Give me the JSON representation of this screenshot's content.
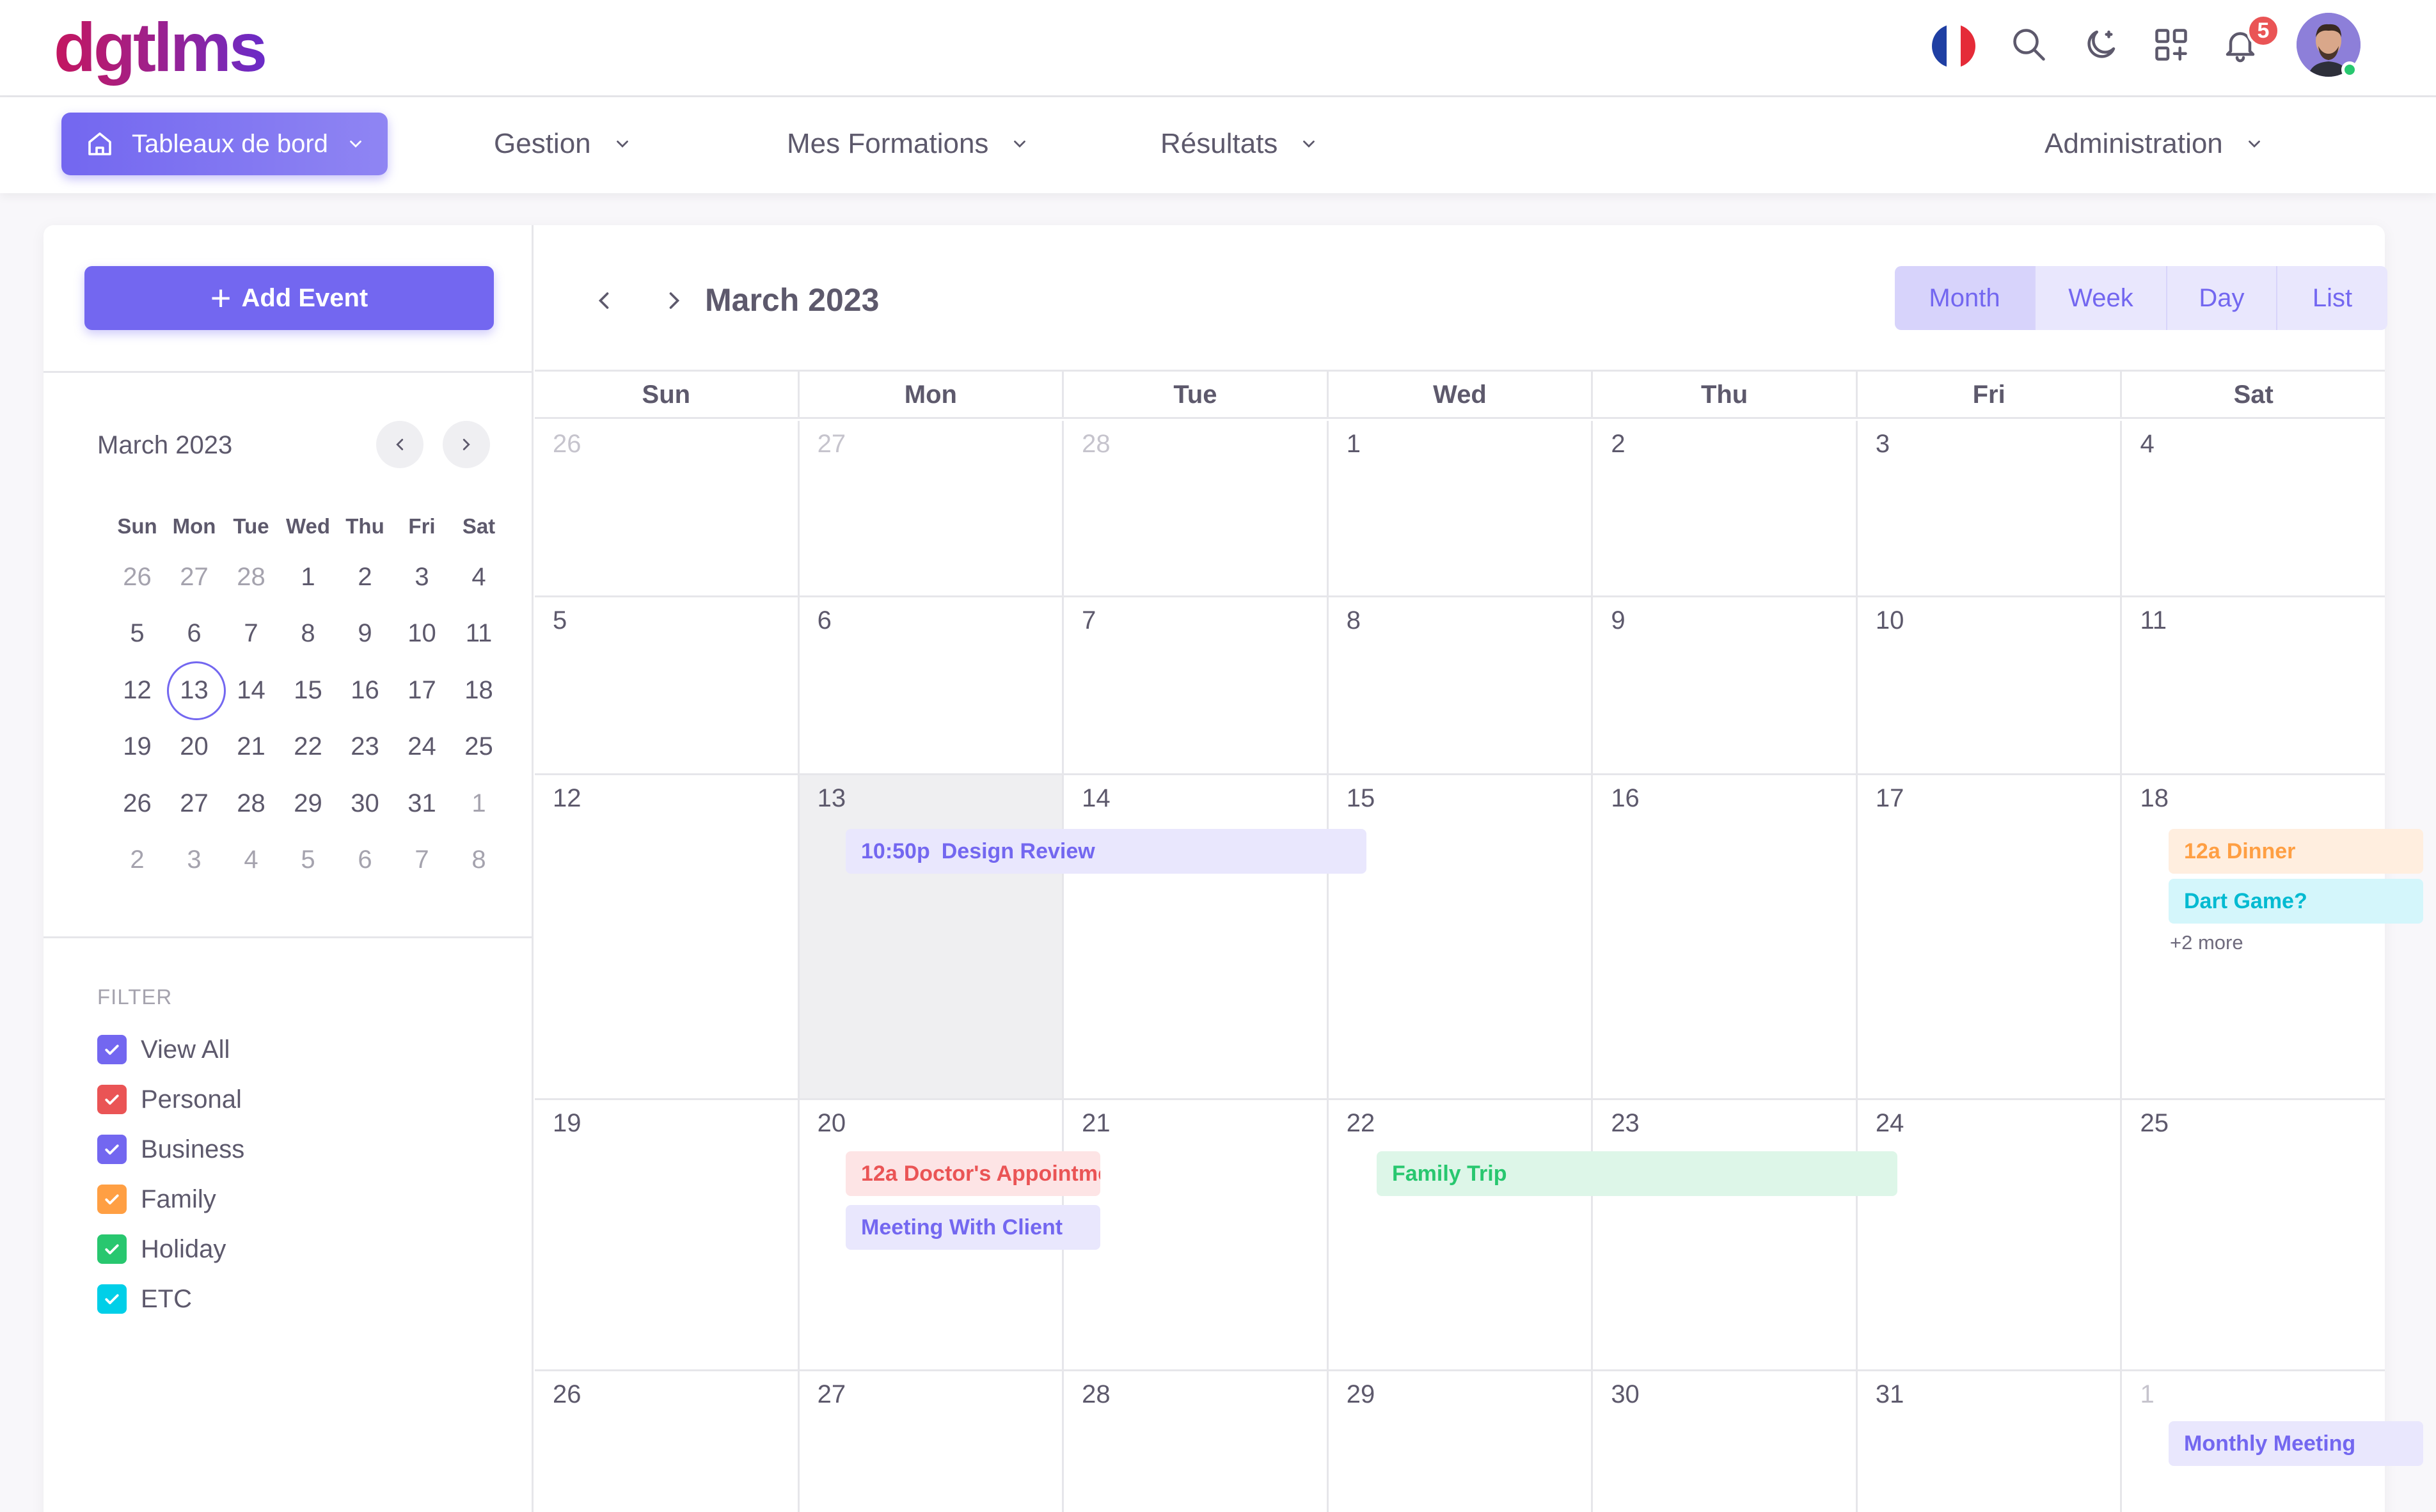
{
  "brand": {
    "logo": "dgtlms"
  },
  "topbar": {
    "notifications_count": "5",
    "language": "FR"
  },
  "menu": {
    "dashboards": "Tableaux de bord",
    "gestion": "Gestion",
    "formations": "Mes Formations",
    "resultats": "Résultats",
    "administration": "Administration"
  },
  "sidebar": {
    "add_event": "Add Event",
    "mini_calendar": {
      "title": "March 2023",
      "weekdays": [
        "Sun",
        "Mon",
        "Tue",
        "Wed",
        "Thu",
        "Fri",
        "Sat"
      ],
      "weeks": [
        [
          "26",
          "27",
          "28",
          "1",
          "2",
          "3",
          "4"
        ],
        [
          "5",
          "6",
          "7",
          "8",
          "9",
          "10",
          "11"
        ],
        [
          "12",
          "13",
          "14",
          "15",
          "16",
          "17",
          "18"
        ],
        [
          "19",
          "20",
          "21",
          "22",
          "23",
          "24",
          "25"
        ],
        [
          "26",
          "27",
          "28",
          "29",
          "30",
          "31",
          "1"
        ],
        [
          "2",
          "3",
          "4",
          "5",
          "6",
          "7",
          "8"
        ]
      ],
      "today": "13"
    },
    "filter": {
      "title": "FILTER",
      "items": [
        {
          "label": "View All",
          "color": "#7367f0",
          "checked": true
        },
        {
          "label": "Personal",
          "color": "#ea5455",
          "checked": true
        },
        {
          "label": "Business",
          "color": "#7367f0",
          "checked": true
        },
        {
          "label": "Family",
          "color": "#ff9f43",
          "checked": true
        },
        {
          "label": "Holiday",
          "color": "#28c76f",
          "checked": true
        },
        {
          "label": "ETC",
          "color": "#00cfe8",
          "checked": true
        }
      ]
    }
  },
  "calendar": {
    "title": "March 2023",
    "views": [
      "Month",
      "Week",
      "Day",
      "List"
    ],
    "active_view": "Month",
    "weekdays": [
      "Sun",
      "Mon",
      "Tue",
      "Wed",
      "Thu",
      "Fri",
      "Sat"
    ],
    "weeks": [
      [
        "26",
        "27",
        "28",
        "1",
        "2",
        "3",
        "4"
      ],
      [
        "5",
        "6",
        "7",
        "8",
        "9",
        "10",
        "11"
      ],
      [
        "12",
        "13",
        "14",
        "15",
        "16",
        "17",
        "18"
      ],
      [
        "19",
        "20",
        "21",
        "22",
        "23",
        "24",
        "25"
      ],
      [
        "26",
        "27",
        "28",
        "29",
        "30",
        "31",
        "1"
      ]
    ],
    "today": "13",
    "events": {
      "design_review_time": "10:50p",
      "design_review_title": "Design Review",
      "dinner_time": "12a",
      "dinner_title": "Dinner",
      "dart_game": "Dart Game?",
      "more": "+2 more",
      "doctor_time": "12a",
      "doctor_title": "Doctor's Appointment",
      "meeting_client": "Meeting With Client",
      "family_trip": "Family Trip",
      "monthly_meeting": "Monthly Meeting"
    },
    "colors": {
      "business": "#7367f0",
      "personal": "#ea5455",
      "family": "#ff9f43",
      "holiday": "#28c76f",
      "etc": "#00cfe8"
    }
  }
}
